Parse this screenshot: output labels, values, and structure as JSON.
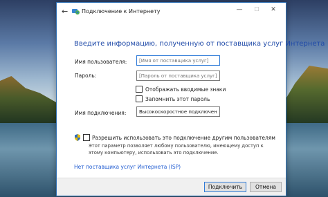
{
  "window": {
    "title": "Подключение к Интернету",
    "heading": "Введите информацию, полученную от поставщика услуг Интернета"
  },
  "form": {
    "username_label": "Имя пользователя:",
    "username_placeholder": "[Имя от поставщика услуг]",
    "password_label": "Пароль:",
    "password_placeholder": "[Пароль от поставщика услуг]",
    "show_chars_label": "Отображать вводимые знаки",
    "remember_label": "Запомнить этот пароль",
    "connection_name_label": "Имя подключения:",
    "connection_name_value": "Высокоскоростное подключение"
  },
  "sharing": {
    "label": "Разрешить использовать это подключение другим пользователям",
    "description": "Этот параметр позволяет любому пользователю, имеющему доступ к этому компьютеру, использовать это подключение."
  },
  "links": {
    "no_isp": "Нет поставщика услуг Интернета (ISP)"
  },
  "buttons": {
    "connect": "Подключить",
    "cancel": "Отмена"
  },
  "colors": {
    "accent": "#1f4aa8",
    "link": "#1f5bd1",
    "focus_border": "#2f7bd8"
  }
}
